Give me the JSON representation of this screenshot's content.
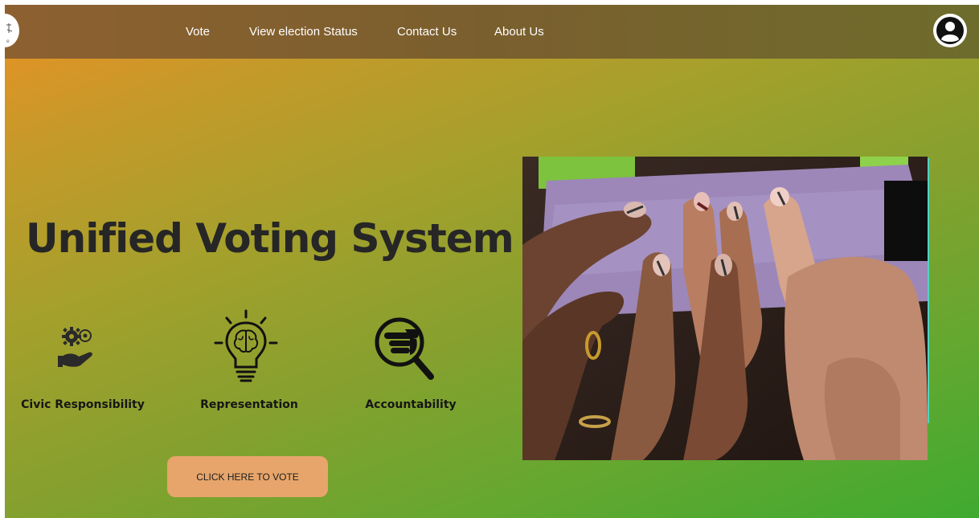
{
  "nav": {
    "links": [
      {
        "label": "Vote"
      },
      {
        "label": "View election Status"
      },
      {
        "label": "Contact Us"
      },
      {
        "label": "About Us"
      }
    ]
  },
  "hero": {
    "title": "Unified Voting System",
    "features": [
      {
        "label": "Civic Responsibility",
        "icon": "gears-hand-icon"
      },
      {
        "label": "Representation",
        "icon": "lightbulb-brain-icon"
      },
      {
        "label": "Accountability",
        "icon": "magnifier-pointing-hand-icon"
      }
    ],
    "cta_label": "CLICK HERE TO VOTE"
  },
  "photo": {
    "subject": "inked-fingers-voting-photo"
  },
  "colors": {
    "nav_bg": "#7a5f2e",
    "gradient_start": "#ec9024",
    "gradient_end": "#3faa30",
    "button_bg": "#e7a56b",
    "title_color": "#262626"
  }
}
